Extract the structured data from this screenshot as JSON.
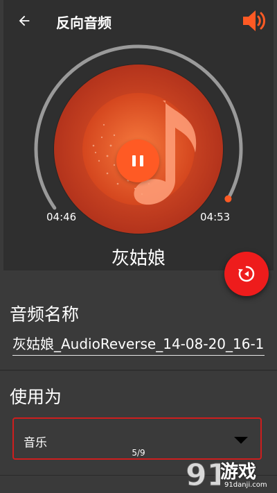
{
  "header": {
    "title": "反向音频",
    "back_icon": "arrow-left-icon",
    "volume_icon": "speaker-volume-icon"
  },
  "player": {
    "elapsed": "04:46",
    "total": "04:53",
    "progress": 0.976,
    "song_title": "灰姑娘",
    "pause_icon": "pause-icon",
    "accent_color": "#ff5a24"
  },
  "form": {
    "audio_name_label": "音频名称",
    "audio_name_value": "灰姑娘_AudioReverse_14-08-20_16-1",
    "use_as_label": "使用为",
    "use_as_selected": "音乐"
  },
  "reverse_button": {
    "icon": "reverse-play-icon",
    "color": "#ee1c1c"
  },
  "page_indicator": "5/9",
  "watermark": {
    "brand": "游戏",
    "url": "91danji.com"
  }
}
